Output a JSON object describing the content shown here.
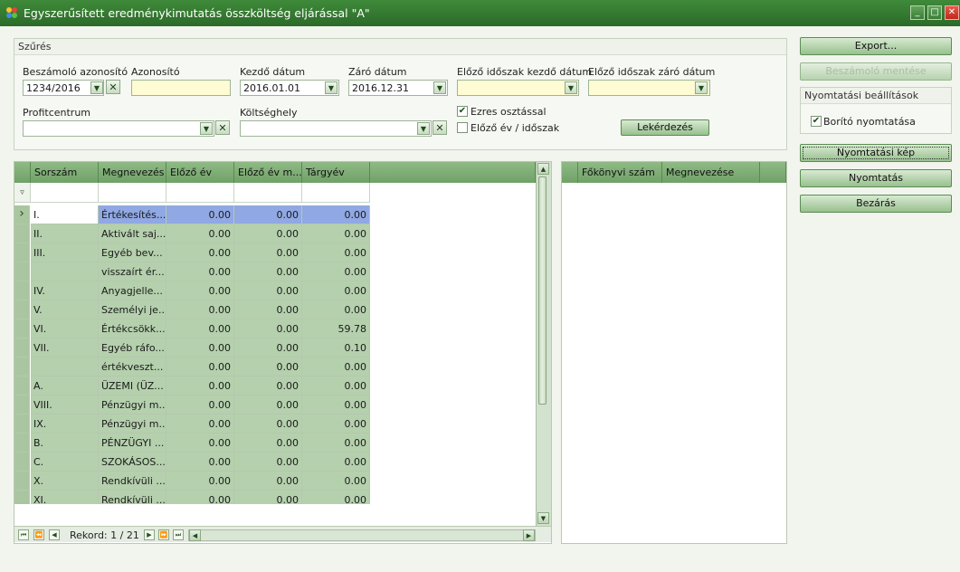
{
  "window": {
    "title": "Egyszerűsített eredménykimutatás összköltség eljárással \"A\"",
    "icon": "app-logo-icon",
    "min": "_",
    "max": "□",
    "close": "✕"
  },
  "filter": {
    "title": "Szűrés",
    "beszamolo": {
      "label": "Beszámoló azonosító",
      "value": "1234/2016"
    },
    "azonosito": {
      "label": "Azonosító",
      "value": ""
    },
    "kezdo": {
      "label": "Kezdő dátum",
      "value": "2016.01.01"
    },
    "zaro": {
      "label": "Záró dátum",
      "value": "2016.12.31"
    },
    "elozo_kezdo": {
      "label": "Előző időszak kezdő dátum",
      "value": ""
    },
    "elozo_zaro": {
      "label": "Előző időszak záró dátum",
      "value": ""
    },
    "profitcentrum": {
      "label": "Profitcentrum",
      "value": ""
    },
    "koltseghely": {
      "label": "Költséghely",
      "value": ""
    },
    "ezres": {
      "label": "Ezres osztással",
      "checked": true
    },
    "elozo_ev": {
      "label": "Előző év / időszak",
      "checked": false
    },
    "query_button": "Lekérdezés"
  },
  "grid": {
    "columns": [
      "Sorszám",
      "Megnevezés",
      "Előző év",
      "Előző év m...",
      "Tárgyév"
    ],
    "rows": [
      {
        "sorszam": "I.",
        "megnevezes": "Értékesítés...",
        "elozo": "0.00",
        "elozo_m": "0.00",
        "targy": "0.00"
      },
      {
        "sorszam": "II.",
        "megnevezes": "Aktivált saj...",
        "elozo": "0.00",
        "elozo_m": "0.00",
        "targy": "0.00"
      },
      {
        "sorszam": "III.",
        "megnevezes": "Egyéb bev...",
        "elozo": "0.00",
        "elozo_m": "0.00",
        "targy": "0.00"
      },
      {
        "sorszam": "",
        "megnevezes": "visszaírt ér...",
        "elozo": "0.00",
        "elozo_m": "0.00",
        "targy": "0.00"
      },
      {
        "sorszam": "IV.",
        "megnevezes": "Anyagjelle...",
        "elozo": "0.00",
        "elozo_m": "0.00",
        "targy": "0.00"
      },
      {
        "sorszam": "V.",
        "megnevezes": "Személyi je...",
        "elozo": "0.00",
        "elozo_m": "0.00",
        "targy": "0.00"
      },
      {
        "sorszam": "VI.",
        "megnevezes": "Értékcsökk...",
        "elozo": "0.00",
        "elozo_m": "0.00",
        "targy": "59.78"
      },
      {
        "sorszam": "VII.",
        "megnevezes": "Egyéb ráfo...",
        "elozo": "0.00",
        "elozo_m": "0.00",
        "targy": "0.10"
      },
      {
        "sorszam": "",
        "megnevezes": "értékveszt...",
        "elozo": "0.00",
        "elozo_m": "0.00",
        "targy": "0.00"
      },
      {
        "sorszam": "A.",
        "megnevezes": "ÜZEMI (ÜZ...",
        "elozo": "0.00",
        "elozo_m": "0.00",
        "targy": "0.00"
      },
      {
        "sorszam": "VIII.",
        "megnevezes": "Pénzügyi m...",
        "elozo": "0.00",
        "elozo_m": "0.00",
        "targy": "0.00"
      },
      {
        "sorszam": "IX.",
        "megnevezes": "Pénzügyi m...",
        "elozo": "0.00",
        "elozo_m": "0.00",
        "targy": "0.00"
      },
      {
        "sorszam": "B.",
        "megnevezes": "PÉNZÜGYI ...",
        "elozo": "0.00",
        "elozo_m": "0.00",
        "targy": "0.00"
      },
      {
        "sorszam": "C.",
        "megnevezes": "SZOKÁSOS...",
        "elozo": "0.00",
        "elozo_m": "0.00",
        "targy": "0.00"
      },
      {
        "sorszam": "X.",
        "megnevezes": "Rendkívüli ...",
        "elozo": "0.00",
        "elozo_m": "0.00",
        "targy": "0.00"
      },
      {
        "sorszam": "XI.",
        "megnevezes": "Rendkívüli ...",
        "elozo": "0.00",
        "elozo_m": "0.00",
        "targy": "0.00"
      }
    ],
    "record_label": "Rekord: 1 / 21"
  },
  "detail_grid": {
    "columns": [
      "Főkönyvi szám",
      "Megnevezése"
    ]
  },
  "actions": {
    "export": "Export...",
    "save": "Beszámoló mentése",
    "print_settings_title": "Nyomtatási beállítások",
    "cover_print": {
      "label": "Borító nyomtatása",
      "checked": true
    },
    "preview": "Nyomtatási kép",
    "print": "Nyomtatás",
    "close": "Bezárás"
  },
  "colors": {
    "title_bar": "#2f6f2b",
    "header": "#80ad77",
    "row": "#b5d0ad",
    "selection": "#90a8e3",
    "input_highlight": "#fffbd2"
  }
}
